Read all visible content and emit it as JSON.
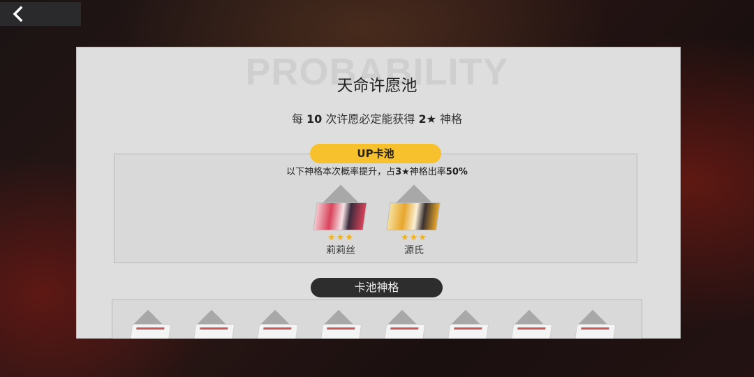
{
  "nav": {
    "back_icon": "chevron-left-icon"
  },
  "panel": {
    "watermark": "PROBABILITY",
    "title": "天命许愿池",
    "guarantee": {
      "pre": "每 ",
      "count": "10",
      "mid": " 次许愿必定能获得 ",
      "rarity": "2★",
      "post": " 神格"
    }
  },
  "up_pool": {
    "label": "UP卡池",
    "desc_pre": "以下神格本次概率提升，占",
    "desc_bold1": "3★",
    "desc_mid": "神格出率",
    "desc_bold2": "50%",
    "cards": [
      {
        "name": "莉莉丝",
        "stars": "★★★",
        "art_colors": [
          "#d9435a",
          "#f3c8cf",
          "#3a2a3a"
        ]
      },
      {
        "name": "源氏",
        "stars": "★★★",
        "art_colors": [
          "#e7a62c",
          "#f6df9c",
          "#3a3030"
        ]
      }
    ]
  },
  "pool_section": {
    "label": "卡池神格",
    "card_count": 8
  }
}
